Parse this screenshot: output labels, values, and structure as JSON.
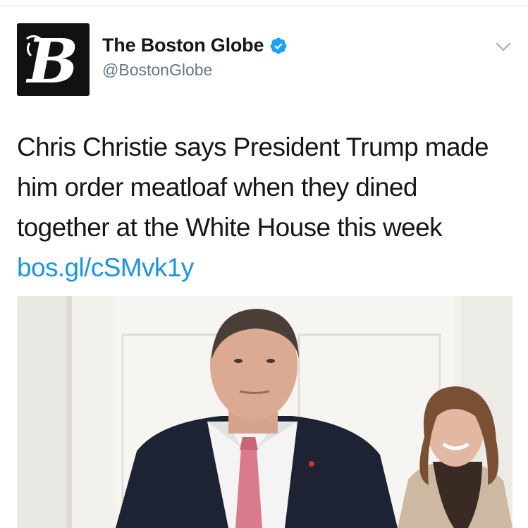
{
  "tweet": {
    "author": {
      "display_name": "The Boston Globe",
      "handle": "@BostonGlobe",
      "verified": true,
      "avatar_glyph": "B",
      "avatar_icon": "boston-globe-logo"
    },
    "menu_icon": "chevron-down-icon",
    "text": "Chris Christie says President Trump made him order meatloaf when they dined together at the White House this week ",
    "link": "bos.gl/cSMvk1y",
    "media": {
      "type": "photo"
    }
  },
  "colors": {
    "link": "#1b95e0",
    "verified_badge": "#1da1f2",
    "handle": "#657786",
    "text": "#14171a"
  }
}
